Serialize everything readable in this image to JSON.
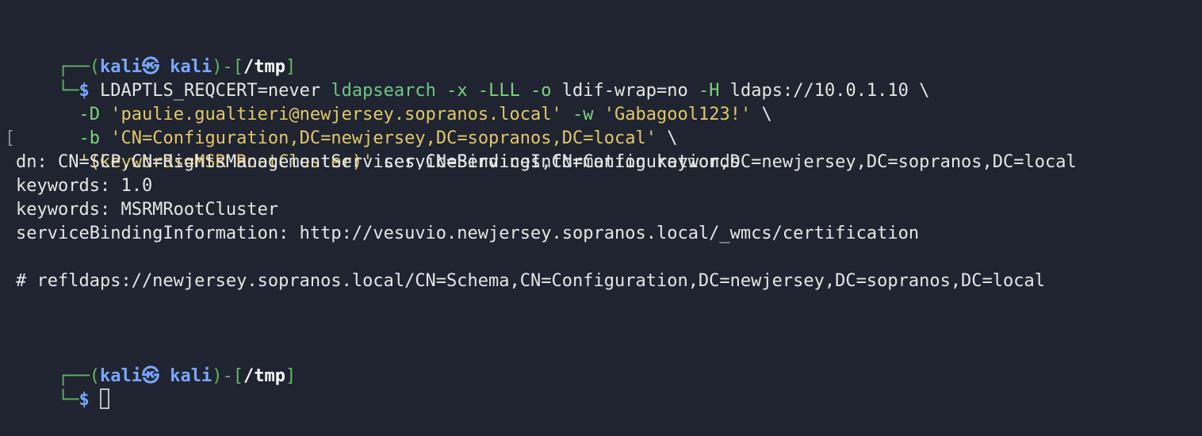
{
  "prompt1": {
    "box_top": "┌──",
    "open_paren": "(",
    "user": "kali",
    "sep_icon": "㉿",
    "host": "kali",
    "close_paren": ")-[",
    "path": "/tmp",
    "close_bracket": "]",
    "box_bottom": "└─",
    "dollar": "$"
  },
  "command": {
    "env": "LDAPTLS_REQCERT=never",
    "bin": "ldapsearch",
    "flags1": "-x -LLL -o",
    "arg_ldif": "ldif-wrap=no",
    "flag_H": "-H",
    "uri": "ldaps://10.0.1.10 \\",
    "flag_D": "-D",
    "bind_dn": "'paulie.gualtieri@newjersey.sopranos.local'",
    "flag_w": "-w",
    "password": "'Gabagool123!'",
    "cont2": " \\",
    "flag_b": "-b",
    "base": "'CN=Configuration,DC=newjersey,DC=sopranos,DC=local'",
    "cont3": " \\",
    "filter": "'(keywords=MSRMRootCluster)'",
    "attrs": "serviceBindingInformation keywords",
    "line4_marker": "["
  },
  "output": {
    "line1": "dn: CN=SCP,CN=RightsManagementServices,CN=Services,CN=Configuration,DC=newjersey,DC=sopranos,DC=local",
    "line2": "keywords: 1.0",
    "line3": "keywords: MSRMRootCluster",
    "line4": "serviceBindingInformation: http://vesuvio.newjersey.sopranos.local/_wmcs/certification",
    "line5": "# refldaps://newjersey.sopranos.local/CN=Schema,CN=Configuration,DC=newjersey,DC=sopranos,DC=local"
  },
  "prompt2": {
    "box_top": "┌──",
    "open_paren": "(",
    "user": "kali",
    "sep_icon": "㉿",
    "host": "kali",
    "close_paren": ")-[",
    "path": "/tmp",
    "close_bracket": "]",
    "box_bottom": "└─",
    "dollar": "$"
  }
}
